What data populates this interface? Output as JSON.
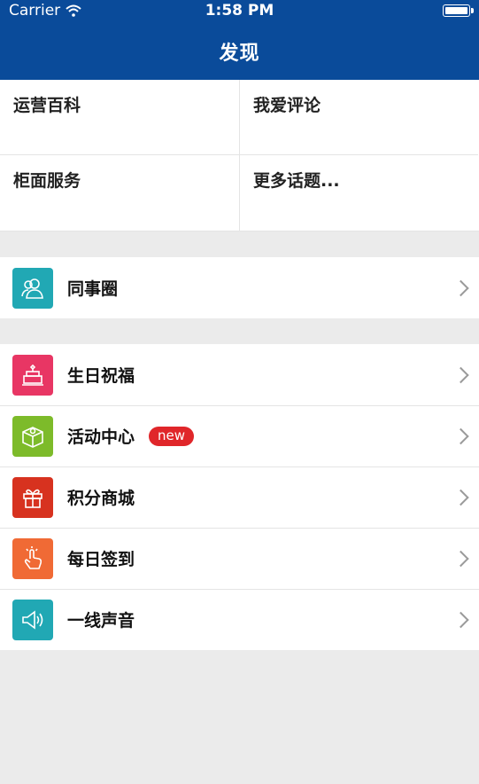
{
  "status_bar": {
    "carrier": "Carrier",
    "time": "1:58 PM"
  },
  "nav": {
    "title": "发现"
  },
  "grid": {
    "items": [
      {
        "label": "运营百科"
      },
      {
        "label": "我爱评论"
      },
      {
        "label": "柜面服务"
      },
      {
        "label": "更多话题..."
      }
    ]
  },
  "section1": {
    "items": [
      {
        "label": "同事圈",
        "icon": "people-icon",
        "color": "#21a8b4"
      }
    ]
  },
  "section2": {
    "items": [
      {
        "label": "生日祝福",
        "icon": "cake-icon",
        "color": "#e83664"
      },
      {
        "label": "活动中心",
        "icon": "box-icon",
        "color": "#7dbb2a",
        "badge": "new"
      },
      {
        "label": "积分商城",
        "icon": "gift-icon",
        "color": "#d7321f"
      },
      {
        "label": "每日签到",
        "icon": "tap-icon",
        "color": "#f06a35"
      },
      {
        "label": "一线声音",
        "icon": "speaker-icon",
        "color": "#21a8b4"
      }
    ]
  },
  "colors": {
    "header": "#0a4b9a",
    "badge": "#e0262a",
    "background": "#ebebeb"
  }
}
